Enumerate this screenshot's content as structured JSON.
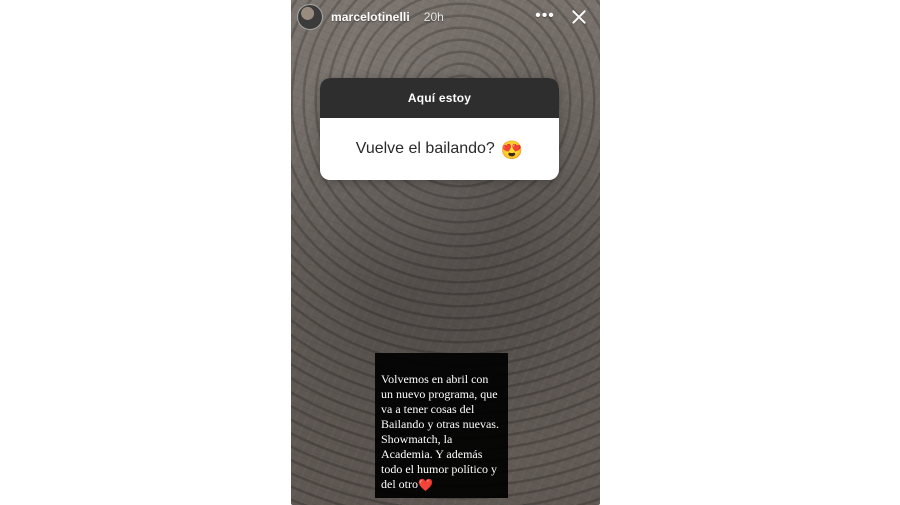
{
  "story": {
    "username": "marcelotinelli",
    "time": "20h",
    "actions": {
      "more": "•••"
    },
    "question": {
      "header": "Aquí estoy",
      "text": "Vuelve el bailando?",
      "emoji": "😍"
    },
    "caption": {
      "text": "Volvemos en abril con\nun nuevo programa, que\nva a tener cosas del\nBailando y otras nuevas.\nShowmatch, la\nAcademia. Y además\ntodo el humor político y\ndel otro",
      "heart": "❤️"
    }
  },
  "icons": {
    "avatar": "avatar",
    "more": "more-icon",
    "close": "close-icon",
    "heart": "heart-icon"
  }
}
